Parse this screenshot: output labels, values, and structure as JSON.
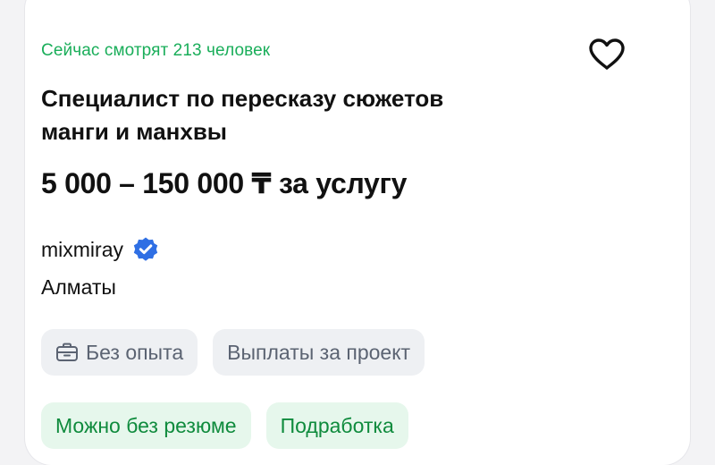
{
  "vacancy": {
    "viewers_text": "Сейчас смотрят 213 человек",
    "title": "Специалист по пересказу сюжетов\nманги и манхвы",
    "salary": "5 000 – 150 000 ₸ за услугу",
    "company": "mixmiray",
    "city": "Алматы",
    "tags_row1": [
      {
        "label": "Без опыта",
        "icon": "briefcase-icon"
      },
      {
        "label": "Выплаты за проект"
      }
    ],
    "tags_row2": [
      {
        "label": "Можно без резюме"
      },
      {
        "label": "Подработка"
      }
    ]
  },
  "icons": {
    "favorite": "heart-icon",
    "verified": "verified-badge-icon"
  },
  "colors": {
    "accent_green": "#1aae5a",
    "verified_blue": "#2f6fe4",
    "chip_gray_bg": "#eef0f3",
    "chip_green_bg": "#e6f7ec"
  }
}
